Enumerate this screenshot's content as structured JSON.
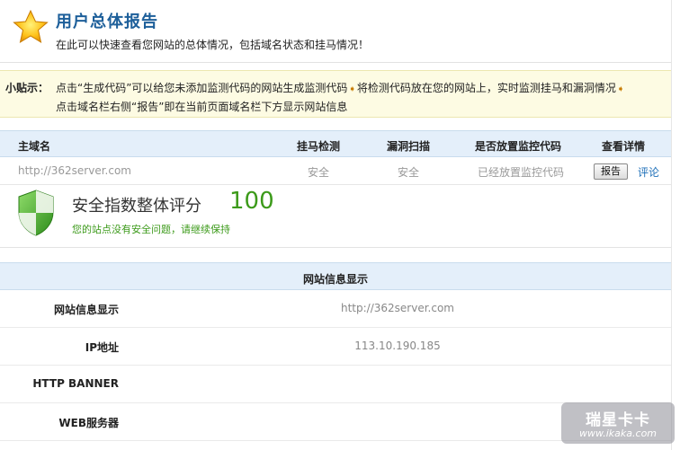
{
  "header": {
    "title": "用户总体报告",
    "subtitle": "在此可以快速查看您网站的总体情况，包括域名状态和挂马情况！"
  },
  "tips": {
    "label": "小贴示：",
    "line1_a": "点击“生成代码”可以给您未添加监测代码的网站生成监测代码",
    "line1_b": "将检测代码放在您的网站上，实时监测挂马和漏洞情况",
    "line2": "点击域名栏右侧“报告”即在当前页面域名栏下方显示网站信息"
  },
  "table": {
    "headers": [
      "主域名",
      "挂马检测",
      "漏洞扫描",
      "是否放置监控代码",
      "查看详情"
    ],
    "row": {
      "domain": "http://362server.com",
      "trojan": "安全",
      "vuln": "安全",
      "monitor": "已经放置监控代码",
      "report_label": "报告",
      "comment_label": "评论"
    }
  },
  "score": {
    "title": "安全指数整体评分",
    "value": "100",
    "note": "您的站点没有安全问题，请继续保持"
  },
  "site_info": {
    "heading": "网站信息显示",
    "rows": [
      {
        "label": "网站信息显示",
        "value": "http://362server.com"
      },
      {
        "label": "IP地址",
        "value": "113.10.190.185"
      },
      {
        "label": "HTTP BANNER",
        "value": ""
      },
      {
        "label": "WEB服务器",
        "value": ""
      }
    ]
  },
  "watermark": {
    "top": "瑞星卡卡",
    "bottom": "www.ikaka.com"
  },
  "colors": {
    "title_blue": "#1d5f9a",
    "score_green": "#3c9a1a",
    "header_bg": "#e4effa",
    "tips_bg": "#fdfbe3"
  },
  "icons": {
    "star": "star-icon",
    "shield": "shield-icon",
    "arrow": "arrow-right-icon"
  }
}
